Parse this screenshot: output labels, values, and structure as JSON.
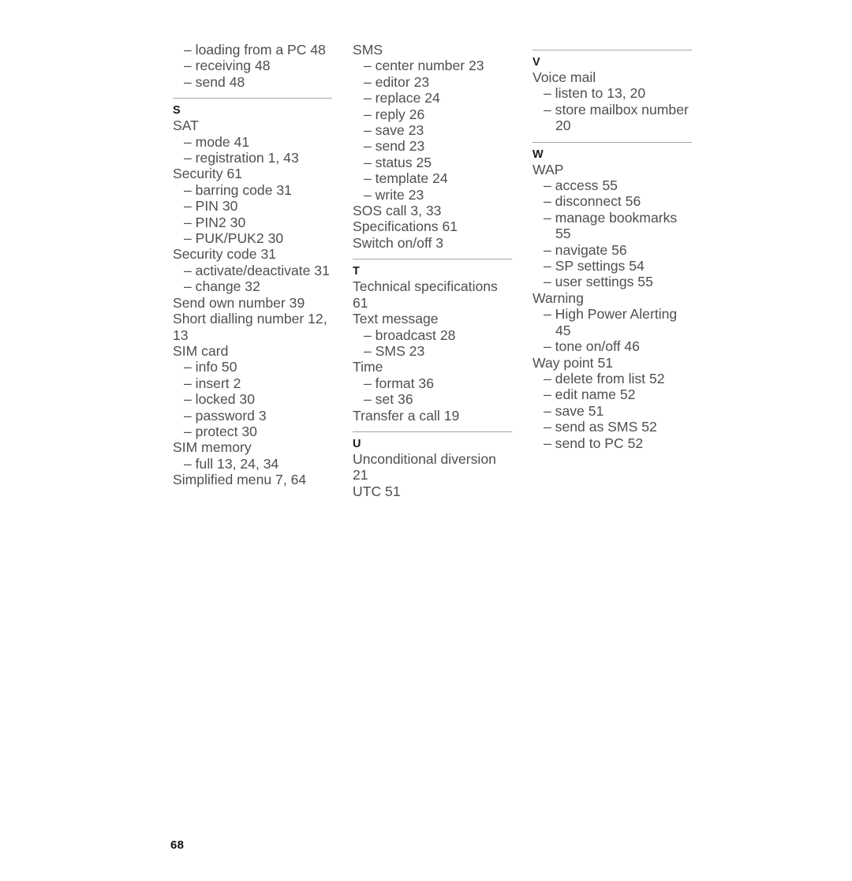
{
  "document": {
    "type": "index",
    "page_number": "68",
    "text_color": "#4f4f51",
    "heading_color": "#1a1a1a",
    "rule_color": "#a6a6a8"
  },
  "columns": [
    {
      "sections": [
        {
          "has_rule": false,
          "letter": null,
          "entries": [
            {
              "sub": true,
              "text": "– loading from a PC 48"
            },
            {
              "sub": true,
              "text": "– receiving 48"
            },
            {
              "sub": true,
              "text": "– send 48"
            }
          ]
        },
        {
          "has_rule": true,
          "letter": "S",
          "entries": [
            {
              "sub": false,
              "text": "SAT"
            },
            {
              "sub": true,
              "text": "– mode 41"
            },
            {
              "sub": true,
              "text": "– registration 1, 43"
            },
            {
              "sub": false,
              "text": "Security 61"
            },
            {
              "sub": true,
              "text": "– barring code 31"
            },
            {
              "sub": true,
              "text": "– PIN 30"
            },
            {
              "sub": true,
              "text": "– PIN2 30"
            },
            {
              "sub": true,
              "text": "– PUK/PUK2 30"
            },
            {
              "sub": false,
              "text": "Security code 31"
            },
            {
              "sub": true,
              "text": "– activate/deactivate 31"
            },
            {
              "sub": true,
              "text": "– change 32"
            },
            {
              "sub": false,
              "text": "Send own number 39"
            },
            {
              "sub": false,
              "text": "Short dialling number 12, 13"
            },
            {
              "sub": false,
              "text": "SIM card"
            },
            {
              "sub": true,
              "text": "– info 50"
            },
            {
              "sub": true,
              "text": "– insert 2"
            },
            {
              "sub": true,
              "text": "– locked 30"
            },
            {
              "sub": true,
              "text": "– password 3"
            },
            {
              "sub": true,
              "text": "– protect 30"
            },
            {
              "sub": false,
              "text": "SIM memory"
            },
            {
              "sub": true,
              "text": "– full 13, 24, 34"
            },
            {
              "sub": false,
              "text": "Simplified menu 7, 64"
            }
          ]
        }
      ]
    },
    {
      "sections": [
        {
          "has_rule": false,
          "letter": null,
          "entries": [
            {
              "sub": false,
              "text": "SMS"
            },
            {
              "sub": true,
              "text": "– center number 23"
            },
            {
              "sub": true,
              "text": "– editor 23"
            },
            {
              "sub": true,
              "text": "– replace 24"
            },
            {
              "sub": true,
              "text": "– reply 26"
            },
            {
              "sub": true,
              "text": "– save 23"
            },
            {
              "sub": true,
              "text": "– send 23"
            },
            {
              "sub": true,
              "text": "– status 25"
            },
            {
              "sub": true,
              "text": "– template 24"
            },
            {
              "sub": true,
              "text": "– write 23"
            },
            {
              "sub": false,
              "text": "SOS call 3, 33"
            },
            {
              "sub": false,
              "text": "Specifications 61"
            },
            {
              "sub": false,
              "text": "Switch on/off 3"
            }
          ]
        },
        {
          "has_rule": true,
          "letter": "T",
          "entries": [
            {
              "sub": false,
              "text": "Technical specifications 61"
            },
            {
              "sub": false,
              "text": "Text message"
            },
            {
              "sub": true,
              "text": "– broadcast 28"
            },
            {
              "sub": true,
              "text": "– SMS 23"
            },
            {
              "sub": false,
              "text": "Time"
            },
            {
              "sub": true,
              "text": "– format 36"
            },
            {
              "sub": true,
              "text": "– set 36"
            },
            {
              "sub": false,
              "text": "Transfer a call 19"
            }
          ]
        },
        {
          "has_rule": true,
          "letter": "U",
          "entries": [
            {
              "sub": false,
              "text": "Unconditional diversion 21"
            },
            {
              "sub": false,
              "text": "UTC 51"
            }
          ]
        }
      ]
    },
    {
      "sections": [
        {
          "has_rule": true,
          "letter": "V",
          "entries": [
            {
              "sub": false,
              "text": "Voice mail"
            },
            {
              "sub": true,
              "text": "– listen to 13, 20"
            },
            {
              "sub": true,
              "text": "– store mailbox number 20"
            }
          ]
        },
        {
          "has_rule": true,
          "letter": "W",
          "entries": [
            {
              "sub": false,
              "text": "WAP"
            },
            {
              "sub": true,
              "text": "– access 55"
            },
            {
              "sub": true,
              "text": "– disconnect 56"
            },
            {
              "sub": true,
              "text": "– manage bookmarks 55"
            },
            {
              "sub": true,
              "text": "– navigate 56"
            },
            {
              "sub": true,
              "text": "– SP settings 54"
            },
            {
              "sub": true,
              "text": "– user settings 55"
            },
            {
              "sub": false,
              "text": "Warning"
            },
            {
              "sub": true,
              "text": "– High Power Alerting 45"
            },
            {
              "sub": true,
              "text": "– tone on/off 46"
            },
            {
              "sub": false,
              "text": "Way point 51"
            },
            {
              "sub": true,
              "text": "– delete from list 52"
            },
            {
              "sub": true,
              "text": "– edit name 52"
            },
            {
              "sub": true,
              "text": "– save 51"
            },
            {
              "sub": true,
              "text": "– send as SMS 52"
            },
            {
              "sub": true,
              "text": "– send to PC 52"
            }
          ]
        }
      ]
    }
  ]
}
